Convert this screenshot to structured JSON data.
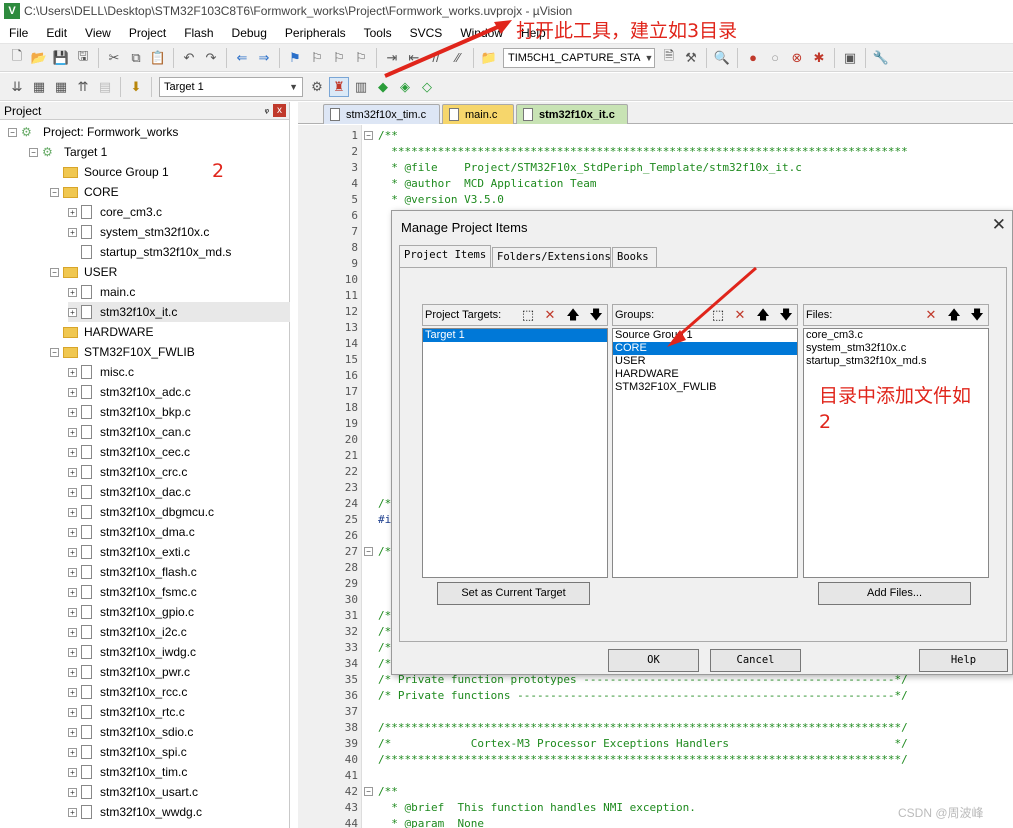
{
  "window": {
    "title": "C:\\Users\\DELL\\Desktop\\STM32F103C8T6\\Formwork_works\\Project\\Formwork_works.uvprojx - µVision",
    "logo": "V"
  },
  "menu": [
    "File",
    "Edit",
    "View",
    "Project",
    "Flash",
    "Debug",
    "Peripherals",
    "Tools",
    "SVCS",
    "Window",
    "Help"
  ],
  "toolbar": {
    "find_combo": "TIM5CH1_CAPTURE_STA",
    "target_combo": "Target 1"
  },
  "annotations": {
    "top": "打开此工具，建立如3目录",
    "left": "2",
    "right": "目录中添加文件如2"
  },
  "project": {
    "header": "Project",
    "pin": "ᵩ",
    "close": "x",
    "root": "Project: Formwork_works",
    "target": "Target 1",
    "groups": [
      {
        "name": "Source Group 1",
        "files": []
      },
      {
        "name": "CORE",
        "files": [
          "core_cm3.c",
          "system_stm32f10x.c",
          "startup_stm32f10x_md.s"
        ]
      },
      {
        "name": "USER",
        "files": [
          "main.c",
          "stm32f10x_it.c"
        ]
      },
      {
        "name": "HARDWARE",
        "files": []
      },
      {
        "name": "STM32F10X_FWLIB",
        "files": [
          "misc.c",
          "stm32f10x_adc.c",
          "stm32f10x_bkp.c",
          "stm32f10x_can.c",
          "stm32f10x_cec.c",
          "stm32f10x_crc.c",
          "stm32f10x_dac.c",
          "stm32f10x_dbgmcu.c",
          "stm32f10x_dma.c",
          "stm32f10x_exti.c",
          "stm32f10x_flash.c",
          "stm32f10x_fsmc.c",
          "stm32f10x_gpio.c",
          "stm32f10x_i2c.c",
          "stm32f10x_iwdg.c",
          "stm32f10x_pwr.c",
          "stm32f10x_rcc.c",
          "stm32f10x_rtc.c",
          "stm32f10x_sdio.c",
          "stm32f10x_spi.c",
          "stm32f10x_tim.c",
          "stm32f10x_usart.c",
          "stm32f10x_wwdg.c"
        ]
      }
    ]
  },
  "tabs": [
    "stm32f10x_tim.c",
    "main.c",
    "stm32f10x_it.c"
  ],
  "code": [
    {
      "n": "1",
      "t": "/**"
    },
    {
      "n": "2",
      "t": "  ******************************************************************************"
    },
    {
      "n": "3",
      "t": "  * @file    Project/STM32F10x_StdPeriph_Template/stm32f10x_it.c"
    },
    {
      "n": "4",
      "t": "  * @author  MCD Application Team"
    },
    {
      "n": "5",
      "t": "  * @version V3.5.0"
    },
    {
      "n": "6",
      "t": ""
    },
    {
      "n": "7",
      "t": ""
    },
    {
      "n": "8",
      "t": ""
    },
    {
      "n": "9",
      "t": ""
    },
    {
      "n": "10",
      "t": ""
    },
    {
      "n": "11",
      "t": ""
    },
    {
      "n": "12",
      "t": ""
    },
    {
      "n": "13",
      "t": ""
    },
    {
      "n": "14",
      "t": ""
    },
    {
      "n": "15",
      "t": ""
    },
    {
      "n": "16",
      "t": ""
    },
    {
      "n": "17",
      "t": ""
    },
    {
      "n": "18",
      "t": ""
    },
    {
      "n": "19",
      "t": ""
    },
    {
      "n": "20",
      "t": ""
    },
    {
      "n": "21",
      "t": ""
    },
    {
      "n": "22",
      "t": ""
    },
    {
      "n": "23",
      "t": ""
    },
    {
      "n": "24",
      "t": "/*"
    },
    {
      "n": "25",
      "t": "#i"
    },
    {
      "n": "26",
      "t": ""
    },
    {
      "n": "27",
      "t": "/*"
    },
    {
      "n": "28",
      "t": ""
    },
    {
      "n": "29",
      "t": ""
    },
    {
      "n": "30",
      "t": ""
    },
    {
      "n": "31",
      "t": "/*"
    },
    {
      "n": "32",
      "t": "/*"
    },
    {
      "n": "33",
      "t": "/*"
    },
    {
      "n": "34",
      "t": "/*"
    },
    {
      "n": "35",
      "t": "/* Private function prototypes -----------------------------------------------*/"
    },
    {
      "n": "36",
      "t": "/* Private functions ---------------------------------------------------------*/"
    },
    {
      "n": "37",
      "t": ""
    },
    {
      "n": "38",
      "t": "/******************************************************************************/"
    },
    {
      "n": "39",
      "t": "/*            Cortex-M3 Processor Exceptions Handlers                         */"
    },
    {
      "n": "40",
      "t": "/******************************************************************************/"
    },
    {
      "n": "41",
      "t": ""
    },
    {
      "n": "42",
      "t": "/**"
    },
    {
      "n": "43",
      "t": "  * @brief  This function handles NMI exception."
    },
    {
      "n": "44",
      "t": "  * @param  None"
    }
  ],
  "dialog": {
    "title": "Manage Project Items",
    "close": "✕",
    "tabs": [
      "Project Items",
      "Folders/Extensions",
      "Books"
    ],
    "targets_label": "Project Targets:",
    "targets": [
      "Target 1"
    ],
    "groups_label": "Groups:",
    "groups": [
      "Source Group 1",
      "CORE",
      "USER",
      "HARDWARE",
      "STM32F10X_FWLIB"
    ],
    "groups_selected": "CORE",
    "files_label": "Files:",
    "files": [
      "core_cm3.c",
      "system_stm32f10x.c",
      "startup_stm32f10x_md.s"
    ],
    "set_target": "Set as Current Target",
    "add_files": "Add Files...",
    "ok": "OK",
    "cancel": "Cancel",
    "help": "Help"
  },
  "watermark": "CSDN @周波峰",
  "colors": {
    "annotation": "#e0251b",
    "selection": "#0078d7",
    "comment": "#1e8a1e"
  }
}
